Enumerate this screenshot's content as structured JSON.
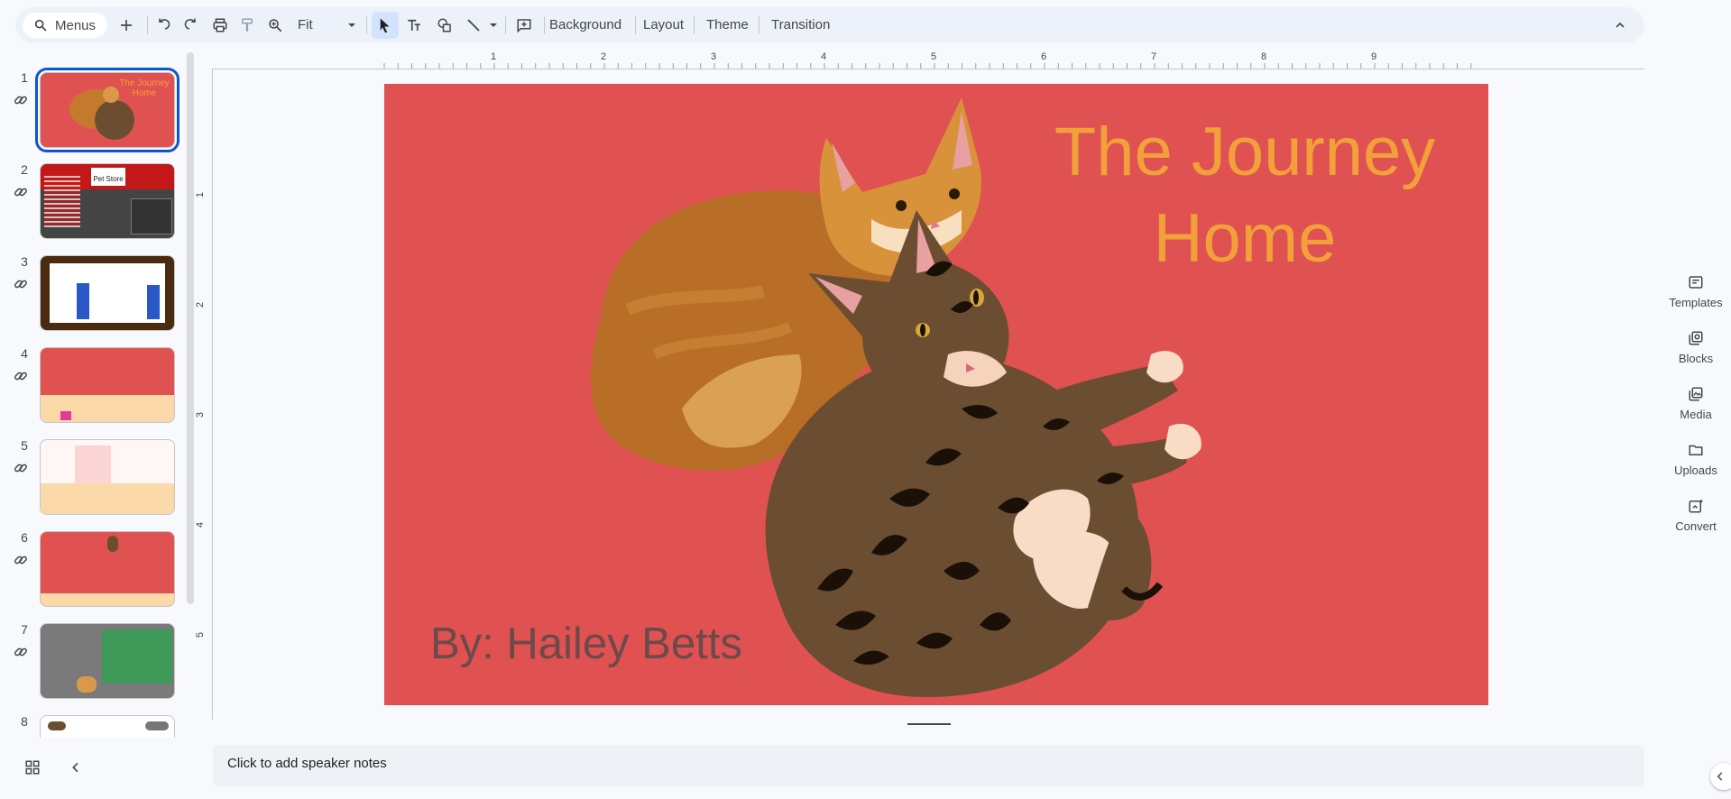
{
  "toolbar": {
    "menus_label": "Menus",
    "zoom_value": "Fit",
    "background_label": "Background",
    "layout_label": "Layout",
    "theme_label": "Theme",
    "transition_label": "Transition"
  },
  "ruler": {
    "horizontal": [
      "1",
      "2",
      "3",
      "4",
      "5",
      "6",
      "7",
      "8",
      "9"
    ],
    "vertical": [
      "1",
      "2",
      "3",
      "4",
      "5"
    ]
  },
  "filmstrip": {
    "slides": [
      {
        "number": "1",
        "selected": true
      },
      {
        "number": "2"
      },
      {
        "number": "3"
      },
      {
        "number": "4"
      },
      {
        "number": "5"
      },
      {
        "number": "6"
      },
      {
        "number": "7"
      },
      {
        "number": "8"
      }
    ],
    "thumb1_title": "The Journey Home",
    "thumb2_sign": "Pet Store"
  },
  "slide": {
    "title": "The Journey Home",
    "author": "By: Hailey Betts",
    "background_color": "#e05151",
    "title_color": "#f2a03a"
  },
  "notes": {
    "placeholder": "Click to add speaker notes"
  },
  "right_panel": {
    "templates_label": "Templates",
    "blocks_label": "Blocks",
    "media_label": "Media",
    "uploads_label": "Uploads",
    "convert_label": "Convert"
  }
}
